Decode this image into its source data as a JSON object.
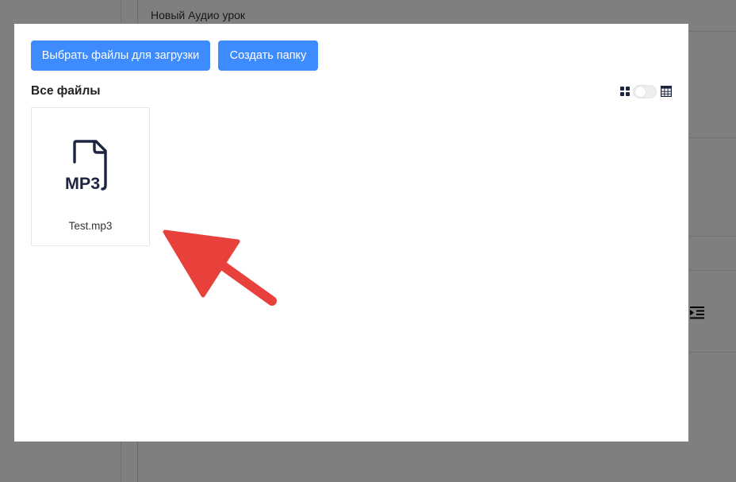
{
  "background": {
    "lesson_title": "Новый Аудио урок"
  },
  "modal": {
    "buttons": {
      "upload_label": "Выбрать файлы для загрузки",
      "create_folder_label": "Создать папку"
    },
    "section_title": "Все файлы",
    "view_toggle": {
      "left_icon": "grid-icon",
      "right_icon": "table-icon",
      "state": "grid"
    },
    "files": [
      {
        "name": "Test.mp3",
        "icon": "mp3-file-icon",
        "icon_label": "MP3"
      }
    ]
  },
  "colors": {
    "primary_button": "#3d8bfd",
    "overlay": "rgba(0,0,0,0.5)",
    "annotation_arrow": "#e8403a",
    "icon_dark": "#1c2440"
  }
}
